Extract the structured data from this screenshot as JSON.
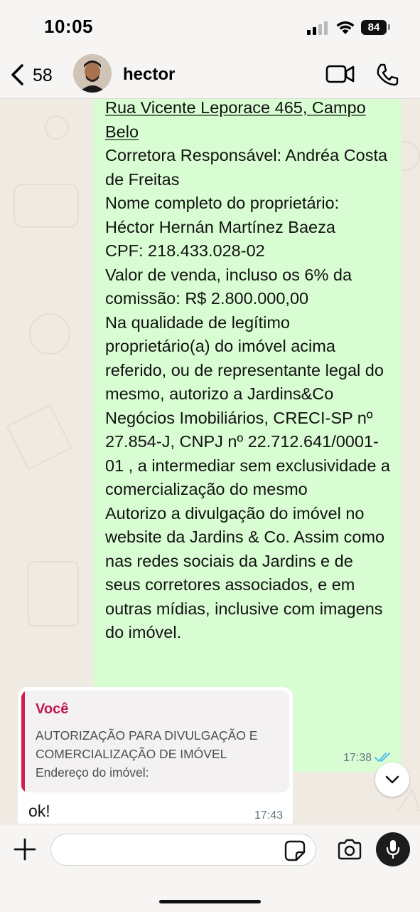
{
  "status_bar": {
    "time": "10:05",
    "battery": "84"
  },
  "header": {
    "unread_count": "58",
    "contact_name": "hector"
  },
  "outgoing_message": {
    "address_link": "Rua Vicente Leporace 465, Campo Belo",
    "text": "Corretora Responsável: Andréa Costa de Freitas\nNome completo do proprietário: Héctor Hernán Martínez Baeza\nCPF: 218.433.028-02\nValor de venda, incluso os 6% da comissão: R$ 2.800.000,00\nNa qualidade de legítimo proprietário(a) do imóvel acima referido, ou de representante legal do mesmo, autorizo a Jardins&Co Negócios Imobiliários, CRECI-SP nº 27.854-J, CNPJ nº 22.712.641/0001-01 , a intermediar sem exclusividade a comercialização do mesmo\nAutorizo a divulgação do imóvel no website da Jardins & Co. Assim como nas redes sociais da Jardins e de seus corretores associados, e em outras mídias, inclusive com imagens do imóvel.",
    "time": "17:38"
  },
  "incoming_message": {
    "quote_author": "Você",
    "quote_text": "AUTORIZAÇÃO PARA DIVULGAÇÃO E\nCOMERCIALIZAÇÃO DE IMÓVEL\nEndereço do imóvel:",
    "text": "ok!",
    "time": "17:43"
  },
  "composer": {
    "placeholder": ""
  },
  "colors": {
    "outgoing_bubble": "#d9fdd3",
    "quote_accent": "#d1204f",
    "read_ticks": "#53bdeb",
    "chat_bg": "#efeae2"
  }
}
